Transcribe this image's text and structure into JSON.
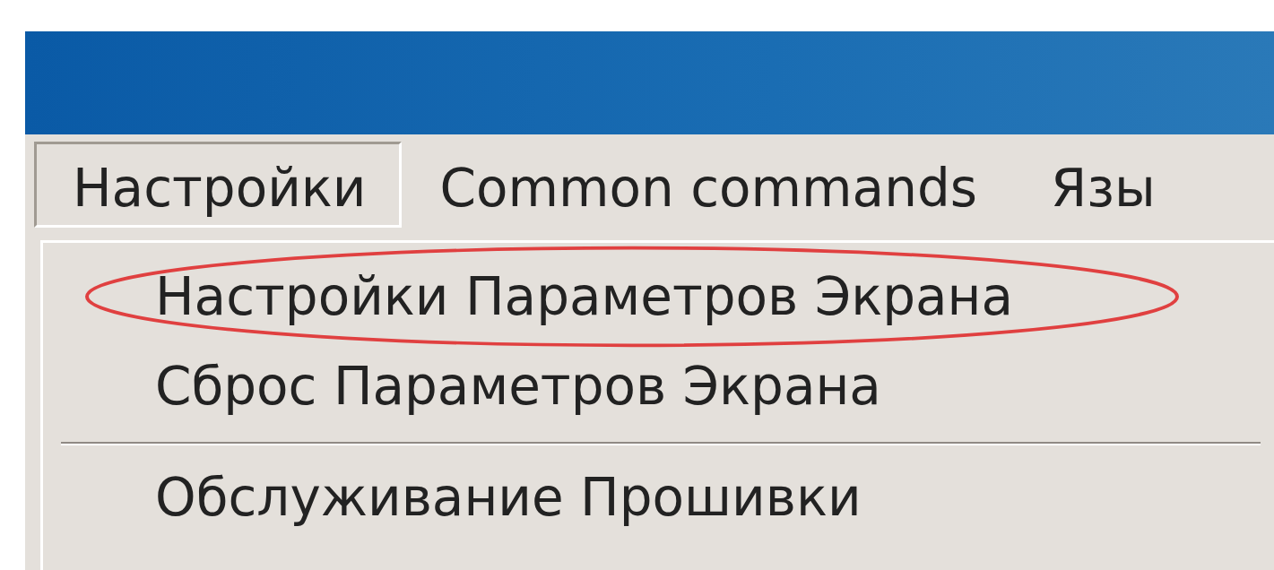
{
  "menu_bar": [
    {
      "label": "Настройки",
      "open": true
    },
    {
      "label": "Common commands",
      "open": false
    },
    {
      "label": "Язы",
      "open": false
    }
  ],
  "dropdown": {
    "items": [
      {
        "kind": "item",
        "label": "Настройки Параметров Экрана",
        "circled": true
      },
      {
        "kind": "item",
        "label": "Сброс Параметров Экрана",
        "circled": false
      },
      {
        "kind": "separator"
      },
      {
        "kind": "item",
        "label": "Обслуживание Прошивки",
        "circled": false
      }
    ]
  }
}
